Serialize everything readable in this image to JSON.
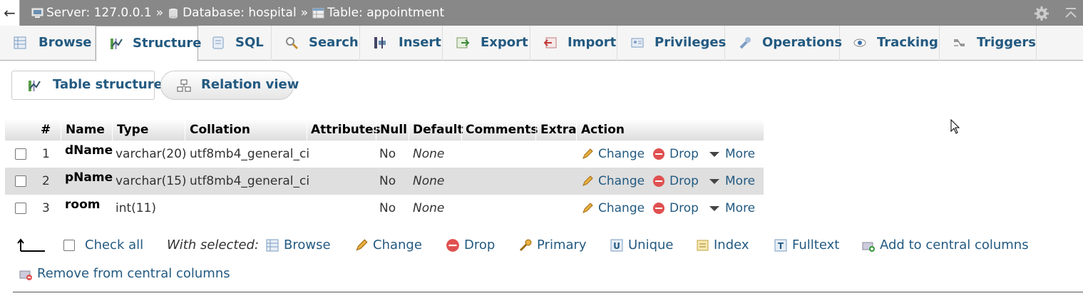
{
  "breadcrumb": {
    "server": "Server: 127.0.0.1",
    "database": "Database: hospital",
    "table": "Table: appointment",
    "separator": "»"
  },
  "tabs": [
    {
      "label": "Browse",
      "icon": "browse-icon"
    },
    {
      "label": "Structure",
      "icon": "structure-icon",
      "active": true
    },
    {
      "label": "SQL",
      "icon": "sql-icon"
    },
    {
      "label": "Search",
      "icon": "search-icon"
    },
    {
      "label": "Insert",
      "icon": "insert-icon"
    },
    {
      "label": "Export",
      "icon": "export-icon"
    },
    {
      "label": "Import",
      "icon": "import-icon"
    },
    {
      "label": "Privileges",
      "icon": "privileges-icon"
    },
    {
      "label": "Operations",
      "icon": "operations-icon"
    },
    {
      "label": "Tracking",
      "icon": "tracking-icon"
    },
    {
      "label": "Triggers",
      "icon": "triggers-icon"
    }
  ],
  "subtabs": {
    "table_structure": "Table structure",
    "relation_view": "Relation view"
  },
  "table": {
    "headers": [
      "#",
      "Name",
      "Type",
      "Collation",
      "Attributes",
      "Null",
      "Default",
      "Comments",
      "Extra",
      "Action"
    ],
    "rows": [
      {
        "num": "1",
        "name": "dName",
        "type": "varchar(20)",
        "collation": "utf8mb4_general_ci",
        "null": "No",
        "default": "None"
      },
      {
        "num": "2",
        "name": "pName",
        "type": "varchar(15)",
        "collation": "utf8mb4_general_ci",
        "null": "No",
        "default": "None"
      },
      {
        "num": "3",
        "name": "room",
        "type": "int(11)",
        "collation": "",
        "null": "No",
        "default": "None"
      }
    ],
    "actions": {
      "change": "Change",
      "drop": "Drop",
      "more": "More"
    }
  },
  "footer": {
    "check_all": "Check all",
    "with_selected": "With selected:",
    "browse": "Browse",
    "change": "Change",
    "drop": "Drop",
    "primary": "Primary",
    "unique": "Unique",
    "index": "Index",
    "fulltext": "Fulltext",
    "add_central": "Add to central columns",
    "remove_central": "Remove from central columns"
  },
  "colors": {
    "link": "#235a81",
    "topbar": "#888888",
    "row_alt": "#dfdfdf"
  }
}
